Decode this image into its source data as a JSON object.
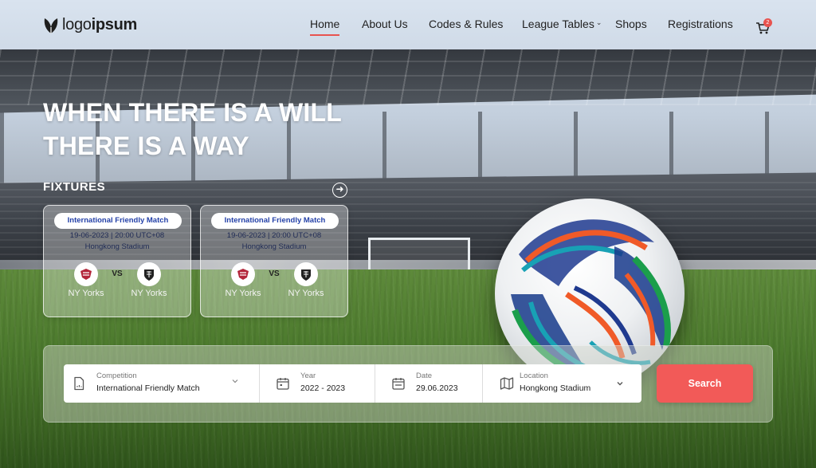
{
  "brand": {
    "logo_light": "logo",
    "logo_bold": "ipsum",
    "accent_color": "#e8534f",
    "search_button_color": "#f25a58"
  },
  "nav": {
    "items": [
      {
        "label": "Home",
        "active": true
      },
      {
        "label": "About Us"
      },
      {
        "label": "Codes & Rules"
      },
      {
        "label": "League Tables",
        "has_dropdown": true
      },
      {
        "label": "Shops"
      },
      {
        "label": "Registrations"
      }
    ],
    "cart": {
      "icon": "cart-icon",
      "count": "2"
    }
  },
  "hero": {
    "title_line1": "WHEN THERE IS A WILL",
    "title_line2": "THERE IS A WAY"
  },
  "fixtures": {
    "heading": "FIXTURES",
    "next_icon": "arrow-right-circle-icon",
    "cards": [
      {
        "competition": "International Friendly Match",
        "datetime": "19-06-2023 | 20:00 UTC+08",
        "venue": "Hongkong Stadium",
        "vs": "VS",
        "home_team": "NY Yorks",
        "away_team": "NY Yorks"
      },
      {
        "competition": "International Friendly Match",
        "datetime": "19-06-2023 | 20:00 UTC+08",
        "venue": "Hongkong Stadium",
        "vs": "VS",
        "home_team": "NY Yorks",
        "away_team": "NY Yorks"
      }
    ]
  },
  "search": {
    "competition": {
      "label": "Competition",
      "value": "International Friendly Match",
      "icon": "document-icon"
    },
    "year": {
      "label": "Year",
      "value": "2022 - 2023",
      "icon": "calendar-icon"
    },
    "date": {
      "label": "Date",
      "value": "29.06.2023",
      "icon": "calendar-icon"
    },
    "location": {
      "label": "Location",
      "value": "Hongkong Stadium",
      "icon": "map-icon"
    },
    "button_label": "Search"
  }
}
